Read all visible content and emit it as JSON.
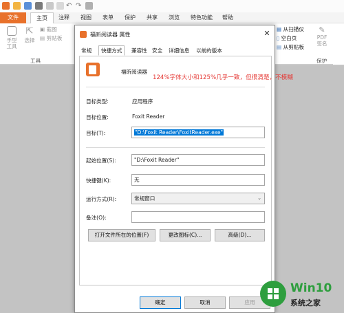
{
  "app": {
    "ribbon_tabs": [
      "文件",
      "主页",
      "注释",
      "视图",
      "表单",
      "保护",
      "共享",
      "浏览",
      "特色功能",
      "帮助"
    ],
    "tools": {
      "hand_label": "手型\n工具",
      "select_label": "选择",
      "screenshot_label": "截图",
      "clipboard_label": "剪贴板",
      "group_label": "工具",
      "scan_label": "从扫描仪",
      "blank_label": "空白页",
      "from_clipboard_label": "从剪贴板",
      "pdf_sign_label": "PDF\n签名",
      "protect_label": "保护"
    }
  },
  "dialog": {
    "title": "福昕阅读器 属性",
    "tabs": [
      "常规",
      "快捷方式",
      "兼容性",
      "安全",
      "详细信息",
      "以前的版本"
    ],
    "active_tab": "快捷方式",
    "app_name": "福昕阅读器",
    "annotation": "124%字体大小和125%几乎一致，但很清楚，不模糊",
    "target_type_label": "目标类型:",
    "target_type_value": "应用程序",
    "target_location_label": "目标位置:",
    "target_location_value": "Foxit Reader",
    "target_label": "目标(T):",
    "target_value": "\"D:\\Foxit Reader\\FoxitReader.exe\"",
    "start_in_label": "起始位置(S):",
    "start_in_value": "\"D:\\Foxit Reader\"",
    "hotkey_label": "快捷键(K):",
    "hotkey_value": "无",
    "run_label": "运行方式(R):",
    "run_value": "常规窗口",
    "comment_label": "备注(O):",
    "comment_value": "",
    "open_location_button": "打开文件所在的位置(F)",
    "change_icon_button": "更改图标(C)...",
    "advanced_button": "高级(D)...",
    "ok_button": "确定",
    "cancel_button": "取消",
    "apply_button": "应用"
  },
  "watermark": {
    "brand": "Win10",
    "tagline": "系统之家"
  },
  "colors": {
    "accent_orange": "#e8712b",
    "selection_blue": "#0078d7",
    "annotation_red": "#e53935",
    "win_green": "#2e9e3e"
  }
}
